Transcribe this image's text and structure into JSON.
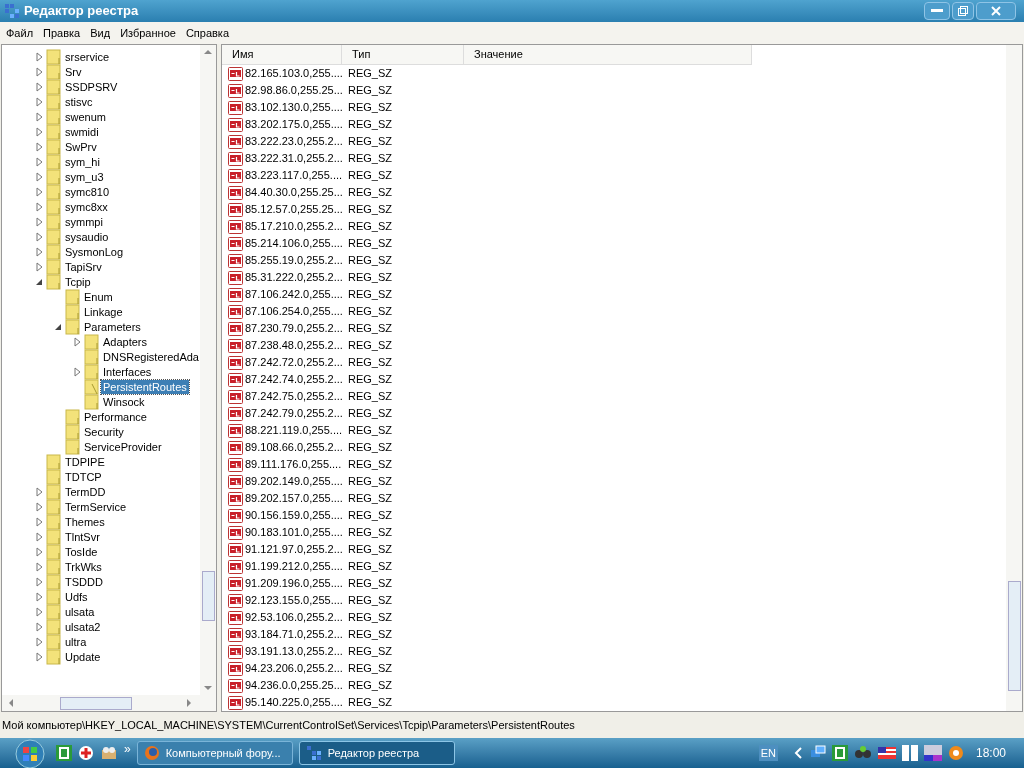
{
  "window": {
    "title": "Редактор реестра"
  },
  "menu": [
    "Файл",
    "Правка",
    "Вид",
    "Избранное",
    "Справка"
  ],
  "tree": [
    {
      "label": "srservice",
      "expanded": false,
      "selected": false
    },
    {
      "label": "Srv",
      "expanded": false,
      "selected": false
    },
    {
      "label": "SSDPSRV",
      "expanded": false,
      "selected": false
    },
    {
      "label": "stisvc",
      "expanded": false,
      "selected": false
    },
    {
      "label": "swenum",
      "expanded": false,
      "selected": false
    },
    {
      "label": "swmidi",
      "expanded": false,
      "selected": false
    },
    {
      "label": "SwPrv",
      "expanded": false,
      "selected": false
    },
    {
      "label": "sym_hi",
      "expanded": false,
      "selected": false
    },
    {
      "label": "sym_u3",
      "expanded": false,
      "selected": false
    },
    {
      "label": "symc810",
      "expanded": false,
      "selected": false
    },
    {
      "label": "symc8xx",
      "expanded": false,
      "selected": false
    },
    {
      "label": "symmpi",
      "expanded": false,
      "selected": false
    },
    {
      "label": "sysaudio",
      "expanded": false,
      "selected": false
    },
    {
      "label": "SysmonLog",
      "expanded": false,
      "selected": false
    },
    {
      "label": "TapiSrv",
      "expanded": false,
      "selected": false
    },
    {
      "label": "Tcpip",
      "expanded": true,
      "selected": false,
      "children": [
        {
          "label": "Enum",
          "selected": false
        },
        {
          "label": "Linkage",
          "selected": false
        },
        {
          "label": "Parameters",
          "expanded": true,
          "selected": false,
          "children": [
            {
              "label": "Adapters",
              "expanded": false,
              "selected": false
            },
            {
              "label": "DNSRegisteredAda",
              "selected": false
            },
            {
              "label": "Interfaces",
              "expanded": false,
              "selected": false
            },
            {
              "label": "PersistentRoutes",
              "selected": true
            },
            {
              "label": "Winsock",
              "selected": false
            }
          ]
        },
        {
          "label": "Performance",
          "selected": false
        },
        {
          "label": "Security",
          "selected": false
        },
        {
          "label": "ServiceProvider",
          "selected": false
        }
      ]
    },
    {
      "label": "TDPIPE",
      "selected": false
    },
    {
      "label": "TDTCP",
      "selected": false
    },
    {
      "label": "TermDD",
      "expanded": false,
      "selected": false
    },
    {
      "label": "TermService",
      "expanded": false,
      "selected": false
    },
    {
      "label": "Themes",
      "expanded": false,
      "selected": false
    },
    {
      "label": "TlntSvr",
      "expanded": false,
      "selected": false
    },
    {
      "label": "TosIde",
      "expanded": false,
      "selected": false
    },
    {
      "label": "TrkWks",
      "expanded": false,
      "selected": false
    },
    {
      "label": "TSDDD",
      "expanded": false,
      "selected": false
    },
    {
      "label": "Udfs",
      "expanded": false,
      "selected": false
    },
    {
      "label": "ulsata",
      "expanded": false,
      "selected": false
    },
    {
      "label": "ulsata2",
      "expanded": false,
      "selected": false
    },
    {
      "label": "ultra",
      "expanded": false,
      "selected": false
    },
    {
      "label": "Update",
      "expanded": false,
      "selected": false
    }
  ],
  "table": {
    "columns": [
      "Имя",
      "Тип",
      "Значение"
    ],
    "rows": [
      [
        "82.165.103.0,255....",
        "REG_SZ"
      ],
      [
        "82.98.86.0,255.25...",
        "REG_SZ"
      ],
      [
        "83.102.130.0,255....",
        "REG_SZ"
      ],
      [
        "83.202.175.0,255....",
        "REG_SZ"
      ],
      [
        "83.222.23.0,255.2...",
        "REG_SZ"
      ],
      [
        "83.222.31.0,255.2...",
        "REG_SZ"
      ],
      [
        "83.223.117.0,255....",
        "REG_SZ"
      ],
      [
        "84.40.30.0,255.25...",
        "REG_SZ"
      ],
      [
        "85.12.57.0,255.25...",
        "REG_SZ"
      ],
      [
        "85.17.210.0,255.2...",
        "REG_SZ"
      ],
      [
        "85.214.106.0,255....",
        "REG_SZ"
      ],
      [
        "85.255.19.0,255.2...",
        "REG_SZ"
      ],
      [
        "85.31.222.0,255.2...",
        "REG_SZ"
      ],
      [
        "87.106.242.0,255....",
        "REG_SZ"
      ],
      [
        "87.106.254.0,255....",
        "REG_SZ"
      ],
      [
        "87.230.79.0,255.2...",
        "REG_SZ"
      ],
      [
        "87.238.48.0,255.2...",
        "REG_SZ"
      ],
      [
        "87.242.72.0,255.2...",
        "REG_SZ"
      ],
      [
        "87.242.74.0,255.2...",
        "REG_SZ"
      ],
      [
        "87.242.75.0,255.2...",
        "REG_SZ"
      ],
      [
        "87.242.79.0,255.2...",
        "REG_SZ"
      ],
      [
        "88.221.119.0,255....",
        "REG_SZ"
      ],
      [
        "89.108.66.0,255.2...",
        "REG_SZ"
      ],
      [
        "89.111.176.0,255....",
        "REG_SZ"
      ],
      [
        "89.202.149.0,255....",
        "REG_SZ"
      ],
      [
        "89.202.157.0,255....",
        "REG_SZ"
      ],
      [
        "90.156.159.0,255....",
        "REG_SZ"
      ],
      [
        "90.183.101.0,255....",
        "REG_SZ"
      ],
      [
        "91.121.97.0,255.2...",
        "REG_SZ"
      ],
      [
        "91.199.212.0,255....",
        "REG_SZ"
      ],
      [
        "91.209.196.0,255....",
        "REG_SZ"
      ],
      [
        "92.123.155.0,255....",
        "REG_SZ"
      ],
      [
        "92.53.106.0,255.2...",
        "REG_SZ"
      ],
      [
        "93.184.71.0,255.2...",
        "REG_SZ"
      ],
      [
        "93.191.13.0,255.2...",
        "REG_SZ"
      ],
      [
        "94.23.206.0,255.2...",
        "REG_SZ"
      ],
      [
        "94.236.0.0,255.25...",
        "REG_SZ"
      ],
      [
        "95.140.225.0,255....",
        "REG_SZ"
      ]
    ]
  },
  "status_bar": "Мой компьютер\\HKEY_LOCAL_MACHINE\\SYSTEM\\CurrentControlSet\\Services\\Tcpip\\Parameters\\PersistentRoutes",
  "taskbar": {
    "overflow": "»",
    "tasks": [
      {
        "label": "Компьютерный фору...",
        "selected": false,
        "kind": "browser"
      },
      {
        "label": "Редактор реестра",
        "selected": true,
        "kind": "regedit"
      }
    ],
    "language": "EN",
    "clock": "18:00"
  }
}
